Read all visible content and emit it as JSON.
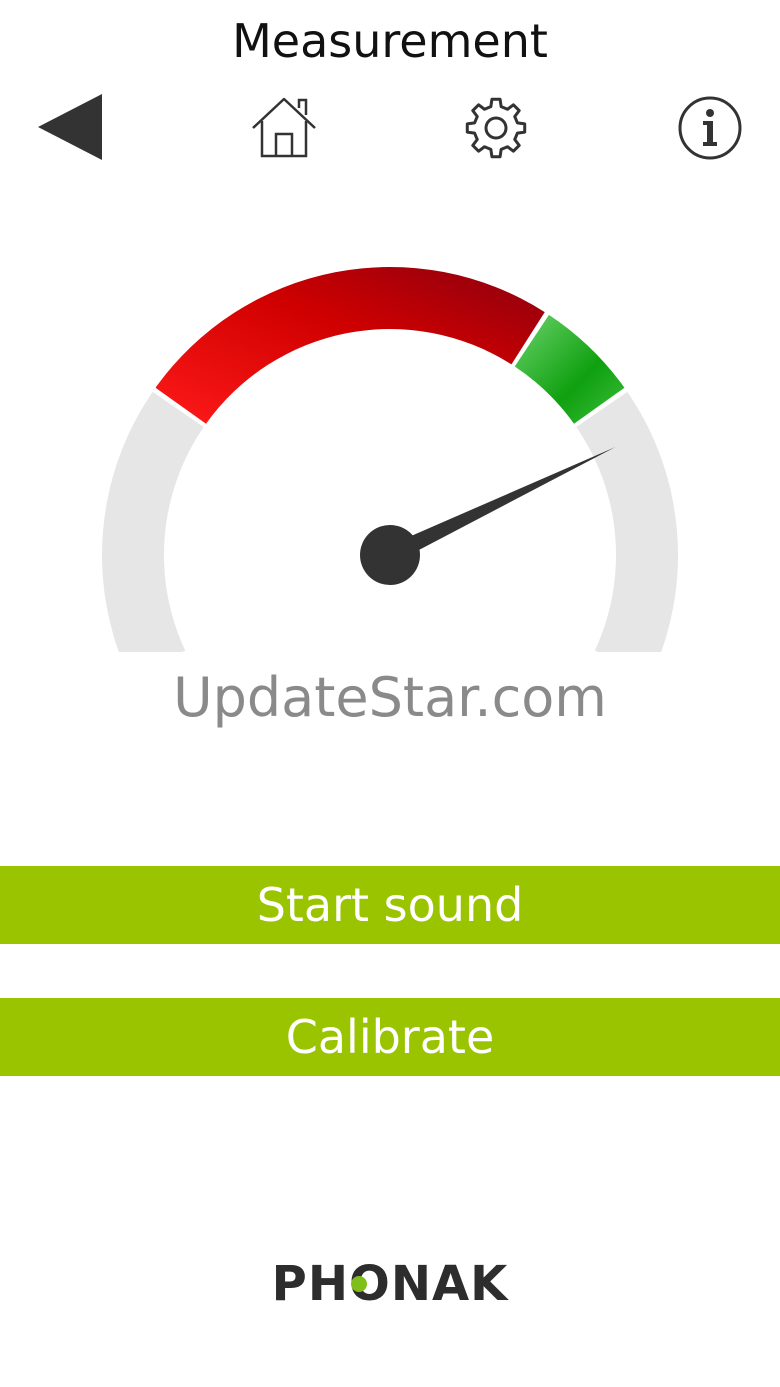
{
  "header": {
    "title": "Measurement"
  },
  "toolbar": {
    "icons": [
      "back-arrow-icon",
      "home-icon",
      "gear-icon",
      "info-icon"
    ]
  },
  "gauge": {
    "level_fraction": 0.78,
    "colors": {
      "track": "#e6e6e6",
      "red_zone": "#e50000",
      "green_zone": "#1aa41a",
      "needle": "#333333"
    }
  },
  "watermark": "UpdateStar.com",
  "actions": {
    "start_label": "Start sound",
    "calibrate_label": "Calibrate",
    "accent": "#9bc400"
  },
  "logo": {
    "text": "PHONAK",
    "dot_color": "#7fbf1c"
  }
}
